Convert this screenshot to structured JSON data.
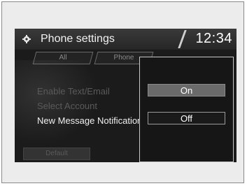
{
  "header": {
    "title": "Phone settings",
    "clock": "12:34",
    "icon": "gear-icon"
  },
  "tabs": [
    {
      "label": "All"
    },
    {
      "label": "Phone"
    }
  ],
  "settings": [
    {
      "label": "Enable Text/Email"
    },
    {
      "label": "Select Account"
    },
    {
      "label": "New Message Notification"
    }
  ],
  "footer": {
    "default_label": "Default"
  },
  "popup": {
    "options": [
      {
        "label": "On",
        "selected": true
      },
      {
        "label": "Off",
        "selected": false
      }
    ]
  }
}
